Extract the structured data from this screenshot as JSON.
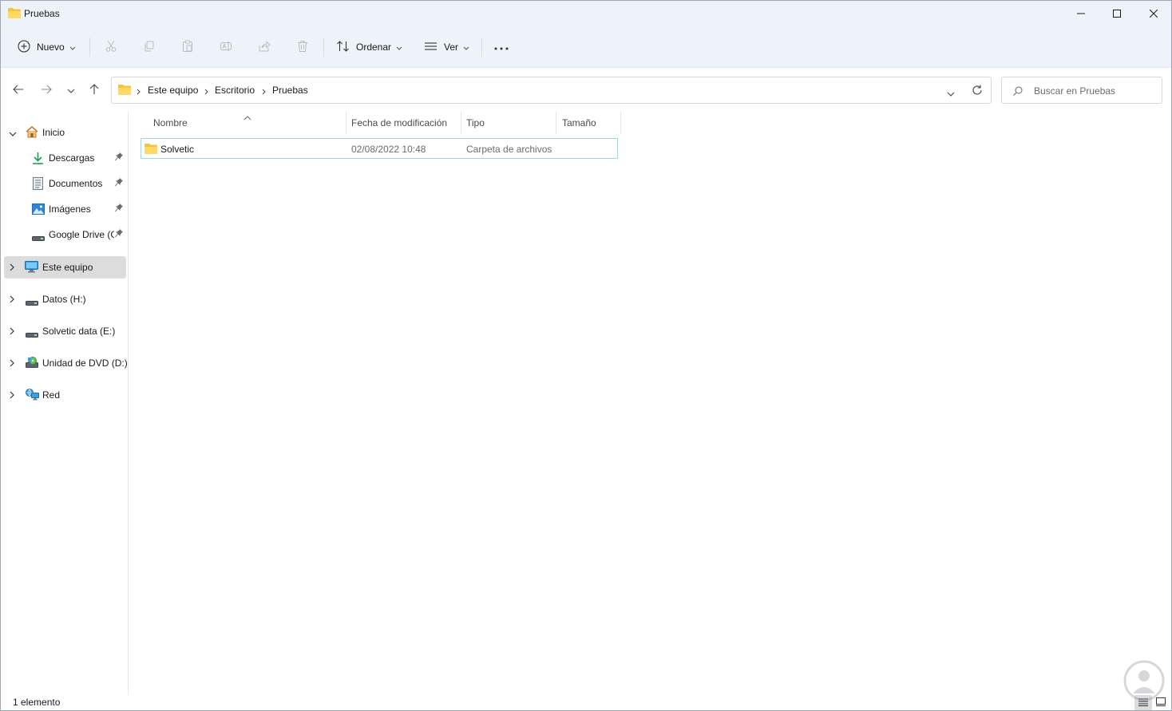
{
  "window": {
    "title": "Pruebas"
  },
  "toolbar": {
    "new_label": "Nuevo",
    "sort_label": "Ordenar",
    "view_label": "Ver"
  },
  "address": {
    "crumbs": [
      "Este equipo",
      "Escritorio",
      "Pruebas"
    ],
    "search_placeholder": "Buscar en Pruebas"
  },
  "sidebar": {
    "home": "Inicio",
    "quick": [
      {
        "label": "Descargas"
      },
      {
        "label": "Documentos"
      },
      {
        "label": "Imágenes"
      },
      {
        "label": "Google Drive (G:)"
      }
    ],
    "this_pc": "Este equipo",
    "drives": [
      {
        "label": "Datos (H:)"
      },
      {
        "label": "Solvetic data (E:)"
      },
      {
        "label": "Unidad de DVD (D:)"
      },
      {
        "label": "Red"
      }
    ]
  },
  "columns": [
    "Nombre",
    "Fecha de modificación",
    "Tipo",
    "Tamaño"
  ],
  "files": [
    {
      "name": "Solvetic",
      "modified": "02/08/2022 10:48",
      "type": "Carpeta de archivos",
      "size": ""
    }
  ],
  "status": {
    "count": "1 elemento"
  },
  "colors": {
    "accent": "#0067c0",
    "folder": "#f5c43b",
    "selection_border": "#99d9ea",
    "chrome": "#eef3f9"
  }
}
